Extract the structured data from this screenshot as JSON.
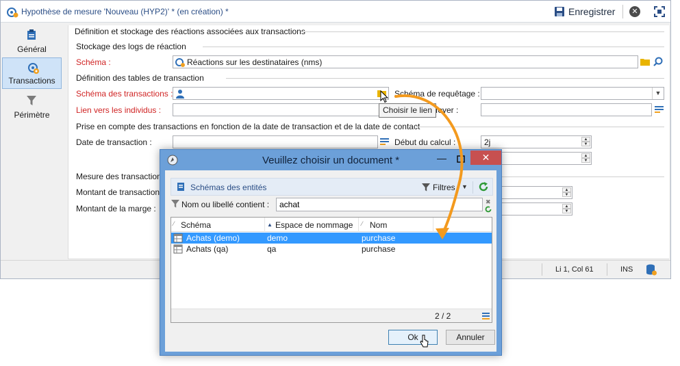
{
  "window": {
    "title": "Hypothèse de mesure 'Nouveau (HYP2)' * (en création) *",
    "save_label": "Enregistrer"
  },
  "sidebar": {
    "items": [
      {
        "label": "Général",
        "icon": "clipboard-icon"
      },
      {
        "label": "Transactions",
        "icon": "target-gear-icon",
        "active": true
      },
      {
        "label": "Périmètre",
        "icon": "funnel-icon"
      }
    ]
  },
  "form": {
    "section_main": "Définition et stockage des réactions associées aux transactions",
    "section_logs": "Stockage des logs de réaction",
    "schema_label": "Schéma :",
    "schema_value": "Réactions sur les destinataires (nms)",
    "section_tables": "Définition des tables de transaction",
    "transactions_schema_label": "Schéma des transactions :",
    "query_schema_label": "Schéma de requêtage :",
    "link_label": "Lien vers les individus :",
    "foyer_label": "foyer :",
    "section_dates": "Prise en compte des transactions en fonction de la date de transaction et de la date de contact",
    "transaction_date_label": "Date de transaction :",
    "calc_start_label": "Début du calcul :",
    "calc_start_value": "2j",
    "section_measure": "Mesure des transaction",
    "amount_label": "Montant de transaction",
    "margin_label": "Montant de la marge :"
  },
  "tooltip": "Choisir le lien",
  "statusbar": {
    "position": "Li 1, Col 61",
    "mode": "INS"
  },
  "dialog": {
    "title": "Veuillez choisir un document *",
    "entity_label": "Schémas des entités",
    "filters_label": "Filtres",
    "filter_label": "Nom ou libellé contient :",
    "filter_value": "achat",
    "columns": [
      "Schéma",
      "Espace de nommage",
      "Nom"
    ],
    "rows": [
      {
        "schema": "Achats (demo)",
        "namespace": "demo",
        "name": "purchase"
      },
      {
        "schema": "Achats (qa)",
        "namespace": "qa",
        "name": "purchase"
      }
    ],
    "count": "2 / 2",
    "ok_label": "Ok",
    "cancel_label": "Annuler"
  },
  "colors": {
    "accent": "#3399ff",
    "required_label": "#d02424",
    "arrow": "#f39a1e",
    "dialog_frame": "#6ca0d9"
  }
}
